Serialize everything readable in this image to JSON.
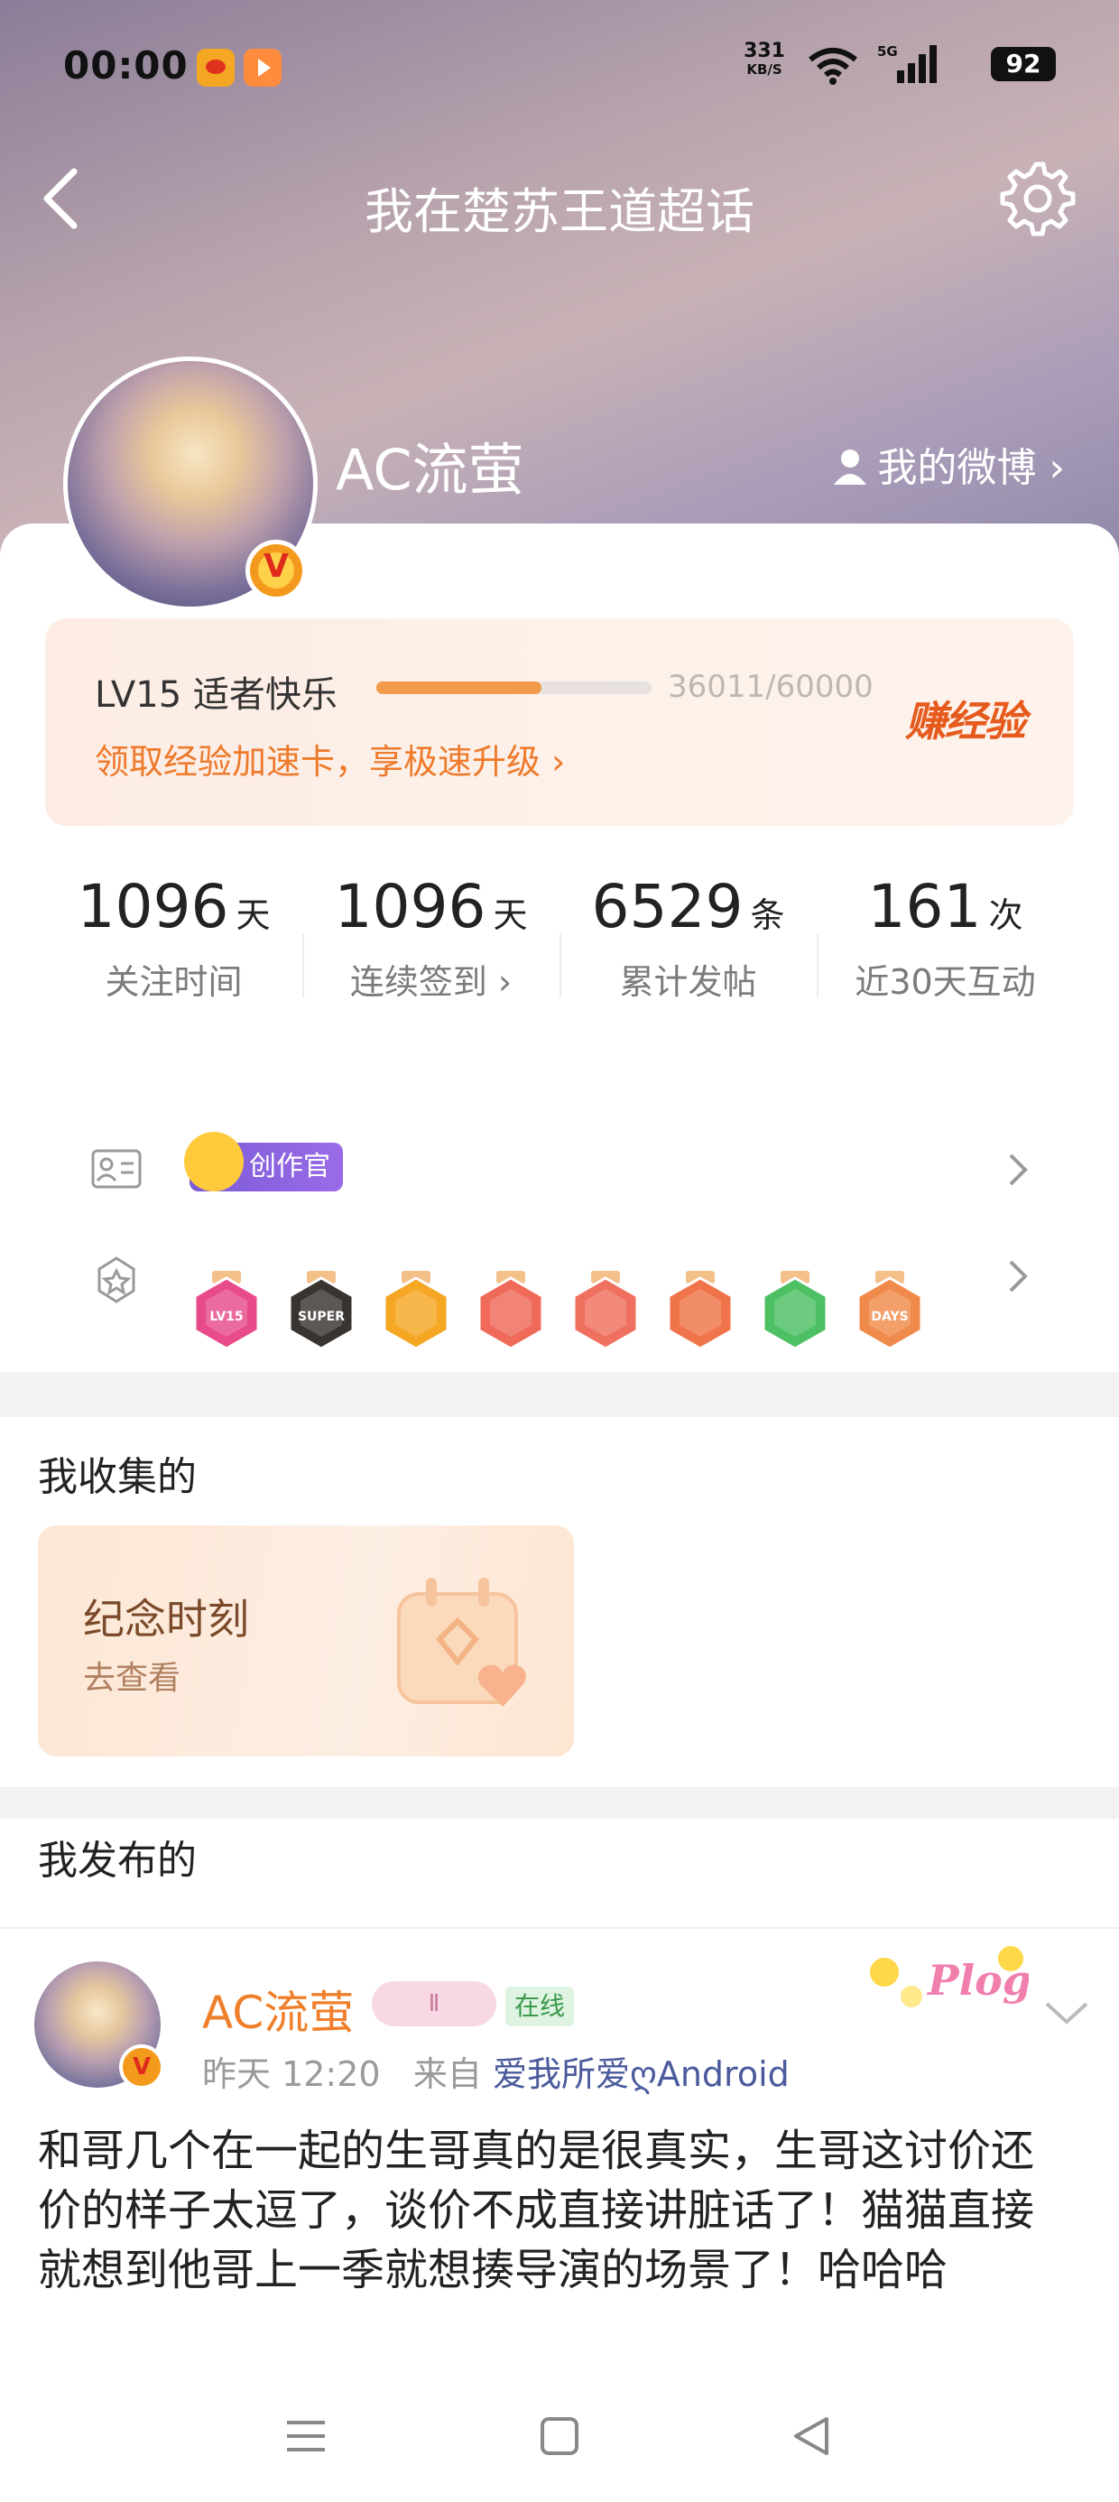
{
  "status_bar": {
    "time": "00:00",
    "net_speed": "331",
    "net_unit": "KB/S",
    "network": "5G",
    "battery": "92"
  },
  "header": {
    "title": "我在楚苏王道超话"
  },
  "profile": {
    "username": "AC流萤",
    "my_weibo": "我的微博"
  },
  "level": {
    "title": "LV15 适者快乐",
    "progress_text": "36011/60000",
    "progress_fraction": 0.6,
    "speedup_link": "领取经验加速卡，享极速升级",
    "earn_label": "赚经验"
  },
  "stats": [
    {
      "value": "1096",
      "unit": "天",
      "label": "关注时间"
    },
    {
      "value": "1096",
      "unit": "天",
      "label": "连续签到"
    },
    {
      "value": "6529",
      "unit": "条",
      "label": "累计发帖"
    },
    {
      "value": "161",
      "unit": "次",
      "label": "近30天互动"
    }
  ],
  "identity": {
    "creator_badge": "创作官"
  },
  "badges": [
    {
      "name": "lv15-badge",
      "text": "LV15",
      "color": "#e84b8a"
    },
    {
      "name": "super-badge",
      "text": "SUPER",
      "color": "#3a3430"
    },
    {
      "name": "crown-badge",
      "text": "",
      "color": "#f5a623"
    },
    {
      "name": "cat-badge-1",
      "text": "",
      "color": "#f06a5a"
    },
    {
      "name": "cat-badge-2",
      "text": "",
      "color": "#f0705f"
    },
    {
      "name": "cat-badge-3",
      "text": "",
      "color": "#f0744a"
    },
    {
      "name": "hand-badge",
      "text": "",
      "color": "#4cc062"
    },
    {
      "name": "100-days-badge",
      "text": "DAYS",
      "color": "#f08a4a"
    }
  ],
  "collected": {
    "section_title": "我收集的",
    "card_title": "纪念时刻",
    "card_link": "去查看"
  },
  "published": {
    "section_title": "我发布的",
    "post": {
      "author": "AC流萤",
      "level_tag": "Ⅱ",
      "online_tag": "在线",
      "time": "昨天 12:20",
      "from_label": "来自",
      "source": "爱我所爱ღAndroid",
      "text": "和哥几个在一起的生哥真的是很真实，生哥这讨价还价的样子太逗了，谈价不成直接讲脏话了！猫猫直接就想到他哥上一季就想揍导演的场景了！哈哈哈"
    }
  },
  "colors": {
    "accent_orange": "#ee7a2c",
    "progress_fill": "#f39a4a",
    "link_blue": "#4a5a9c"
  }
}
